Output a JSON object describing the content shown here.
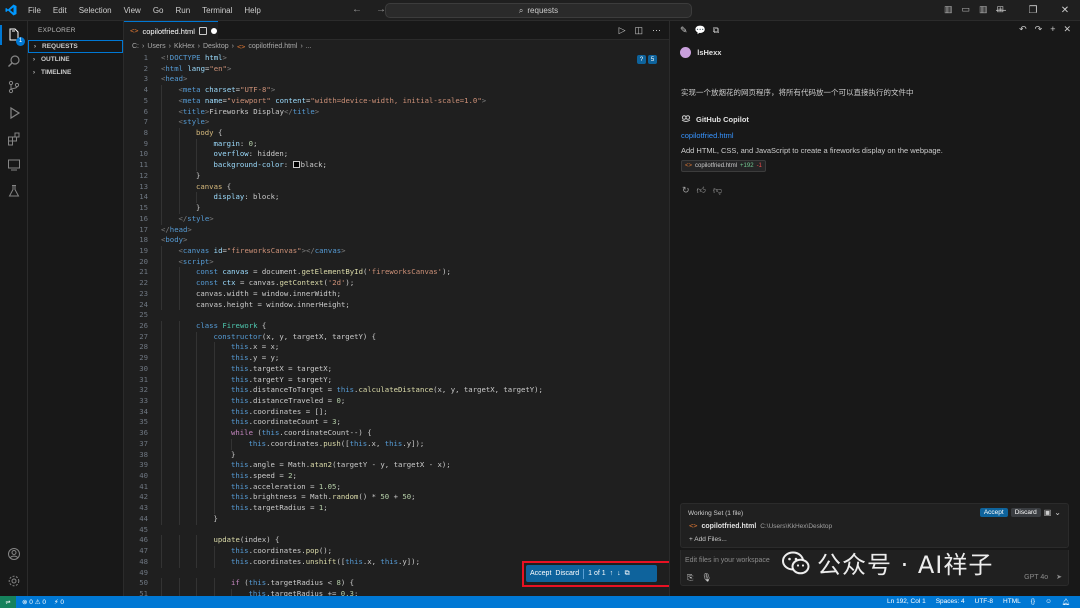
{
  "titlebar": {
    "menu": [
      "File",
      "Edit",
      "Selection",
      "View",
      "Go",
      "Run",
      "Terminal",
      "Help"
    ],
    "search": "requests"
  },
  "activity_bar": {
    "source_control_badge": "1"
  },
  "sidebar": {
    "title": "EXPLORER",
    "sections": [
      "REQUESTS",
      "OUTLINE",
      "TIMELINE"
    ]
  },
  "editor": {
    "tab_label": "copilotfried.html",
    "breadcrumb": [
      "C:",
      "Users",
      "KkHex",
      "Desktop",
      "copilotfried.html",
      "..."
    ],
    "lines": [
      {
        "n": "1",
        "i": 0,
        "h": "<span class='t-br'>&lt;!</span><span class='t-tag'>DOCTYPE</span> <span class='t-attr'>html</span><span class='t-br'>&gt;</span>"
      },
      {
        "n": "2",
        "i": 0,
        "h": "<span class='t-br'>&lt;</span><span class='t-tag'>html</span> <span class='t-attr'>lang</span>=<span class='t-str'>\"en\"</span><span class='t-br'>&gt;</span>"
      },
      {
        "n": "3",
        "i": 0,
        "h": "<span class='t-br'>&lt;</span><span class='t-tag'>head</span><span class='t-br'>&gt;</span>"
      },
      {
        "n": "4",
        "i": 1,
        "h": "<span class='t-br'>&lt;</span><span class='t-tag'>meta</span> <span class='t-attr'>charset</span>=<span class='t-str'>\"UTF-8\"</span><span class='t-br'>&gt;</span>"
      },
      {
        "n": "5",
        "i": 1,
        "h": "<span class='t-br'>&lt;</span><span class='t-tag'>meta</span> <span class='t-attr'>name</span>=<span class='t-str'>\"viewport\"</span> <span class='t-attr'>content</span>=<span class='t-str'>\"width=device-width, initial-scale=1.0\"</span><span class='t-br'>&gt;</span>"
      },
      {
        "n": "6",
        "i": 1,
        "h": "<span class='t-br'>&lt;</span><span class='t-tag'>title</span><span class='t-br'>&gt;</span>Fireworks Display<span class='t-br'>&lt;/</span><span class='t-tag'>title</span><span class='t-br'>&gt;</span>"
      },
      {
        "n": "7",
        "i": 1,
        "h": "<span class='t-br'>&lt;</span><span class='t-tag'>style</span><span class='t-br'>&gt;</span>"
      },
      {
        "n": "8",
        "i": 2,
        "h": "<span class='t-sel'>body</span> {"
      },
      {
        "n": "9",
        "i": 3,
        "h": "<span class='t-attr'>margin</span>: <span class='t-num'>0</span>;"
      },
      {
        "n": "10",
        "i": 3,
        "h": "<span class='t-attr'>overflow</span>: hidden;"
      },
      {
        "n": "11",
        "i": 3,
        "h": "<span class='t-attr'>background-color</span>: <span class='sw'></span>black;"
      },
      {
        "n": "12",
        "i": 2,
        "h": "}"
      },
      {
        "n": "13",
        "i": 2,
        "h": "<span class='t-sel'>canvas</span> {"
      },
      {
        "n": "14",
        "i": 3,
        "h": "<span class='t-attr'>display</span>: block;"
      },
      {
        "n": "15",
        "i": 2,
        "h": "}"
      },
      {
        "n": "16",
        "i": 1,
        "h": "<span class='t-br'>&lt;/</span><span class='t-tag'>style</span><span class='t-br'>&gt;</span>"
      },
      {
        "n": "17",
        "i": 0,
        "h": "<span class='t-br'>&lt;/</span><span class='t-tag'>head</span><span class='t-br'>&gt;</span>"
      },
      {
        "n": "18",
        "i": 0,
        "h": "<span class='t-br'>&lt;</span><span class='t-tag'>body</span><span class='t-br'>&gt;</span>"
      },
      {
        "n": "19",
        "i": 1,
        "h": "<span class='t-br'>&lt;</span><span class='t-tag'>canvas</span> <span class='t-attr'>id</span>=<span class='t-str'>\"fireworksCanvas\"</span><span class='t-br'>&gt;&lt;/</span><span class='t-tag'>canvas</span><span class='t-br'>&gt;</span>"
      },
      {
        "n": "20",
        "i": 1,
        "h": "<span class='t-br'>&lt;</span><span class='t-tag'>script</span><span class='t-br'>&gt;</span>"
      },
      {
        "n": "21",
        "i": 2,
        "h": "<span class='t-kw'>const</span> <span class='t-attr'>canvas</span> = document.<span class='t-fn'>getElementById</span>(<span class='t-str'>'fireworksCanvas'</span>);"
      },
      {
        "n": "22",
        "i": 2,
        "h": "<span class='t-kw'>const</span> <span class='t-attr'>ctx</span> = canvas.<span class='t-fn'>getContext</span>(<span class='t-str'>'2d'</span>);"
      },
      {
        "n": "23",
        "i": 2,
        "h": "canvas.width = window.innerWidth;"
      },
      {
        "n": "24",
        "i": 2,
        "h": "canvas.height = window.innerHeight;"
      },
      {
        "n": "25",
        "i": 0,
        "h": ""
      },
      {
        "n": "26",
        "i": 2,
        "h": "<span class='t-kw'>class</span> <span class='t-cls'>Firework</span> {"
      },
      {
        "n": "27",
        "i": 3,
        "h": "<span class='t-kw'>constructor</span>(x, y, targetX, targetY) {"
      },
      {
        "n": "28",
        "i": 4,
        "h": "<span class='t-kw'>this</span>.x = x;"
      },
      {
        "n": "29",
        "i": 4,
        "h": "<span class='t-kw'>this</span>.y = y;"
      },
      {
        "n": "30",
        "i": 4,
        "h": "<span class='t-kw'>this</span>.targetX = targetX;"
      },
      {
        "n": "31",
        "i": 4,
        "h": "<span class='t-kw'>this</span>.targetY = targetY;"
      },
      {
        "n": "32",
        "i": 4,
        "h": "<span class='t-kw'>this</span>.distanceToTarget = <span class='t-kw'>this</span>.<span class='t-fn'>calculateDistance</span>(x, y, targetX, targetY);"
      },
      {
        "n": "33",
        "i": 4,
        "h": "<span class='t-kw'>this</span>.distanceTraveled = <span class='t-num'>0</span>;"
      },
      {
        "n": "34",
        "i": 4,
        "h": "<span class='t-kw'>this</span>.coordinates = [];"
      },
      {
        "n": "35",
        "i": 4,
        "h": "<span class='t-kw'>this</span>.coordinateCount = <span class='t-num'>3</span>;"
      },
      {
        "n": "36",
        "i": 4,
        "h": "<span class='t-ctl'>while</span> (<span class='t-kw'>this</span>.coordinateCount--) {"
      },
      {
        "n": "37",
        "i": 5,
        "h": "<span class='t-kw'>this</span>.coordinates.<span class='t-fn'>push</span>([<span class='t-kw'>this</span>.x, <span class='t-kw'>this</span>.y]);"
      },
      {
        "n": "38",
        "i": 4,
        "h": "}"
      },
      {
        "n": "39",
        "i": 4,
        "h": "<span class='t-kw'>this</span>.angle = Math.<span class='t-fn'>atan2</span>(targetY - y, targetX - x);"
      },
      {
        "n": "40",
        "i": 4,
        "h": "<span class='t-kw'>this</span>.speed = <span class='t-num'>2</span>;"
      },
      {
        "n": "41",
        "i": 4,
        "h": "<span class='t-kw'>this</span>.acceleration = <span class='t-num'>1.05</span>;"
      },
      {
        "n": "42",
        "i": 4,
        "h": "<span class='t-kw'>this</span>.brightness = Math.<span class='t-fn'>random</span>() * <span class='t-num'>50</span> + <span class='t-num'>50</span>;"
      },
      {
        "n": "43",
        "i": 4,
        "h": "<span class='t-kw'>this</span>.targetRadius = <span class='t-num'>1</span>;"
      },
      {
        "n": "44",
        "i": 3,
        "h": "}"
      },
      {
        "n": "45",
        "i": 0,
        "h": ""
      },
      {
        "n": "46",
        "i": 3,
        "h": "<span class='t-fn'>update</span>(index) {"
      },
      {
        "n": "47",
        "i": 4,
        "h": "<span class='t-kw'>this</span>.coordinates.<span class='t-fn'>pop</span>();"
      },
      {
        "n": "48",
        "i": 4,
        "h": "<span class='t-kw'>this</span>.coordinates.<span class='t-fn'>unshift</span>([<span class='t-kw'>this</span>.x, <span class='t-kw'>this</span>.y]);"
      },
      {
        "n": "49",
        "i": 0,
        "h": ""
      },
      {
        "n": "50",
        "i": 4,
        "h": "<span class='t-ctl'>if</span> (<span class='t-kw'>this</span>.targetRadius &lt; <span class='t-num'>8</span>) {"
      },
      {
        "n": "51",
        "i": 5,
        "h": "<span class='t-kw'>this</span>.targetRadius += <span class='t-num'>0.3</span>;"
      }
    ],
    "accept_bar": {
      "accept": "Accept",
      "discard": "Discard",
      "count": "1 of 1"
    }
  },
  "chat": {
    "user_name": "lsHexx",
    "user_message": "实现一个放烟花的网页程序，将所有代码放一个可以直接执行的文件中",
    "assistant_name": "GitHub Copilot",
    "file_link": "copilotfried.html",
    "description": "Add HTML, CSS, and JavaScript to create a fireworks display on the webpage.",
    "chip": {
      "file": "copilotfried.html",
      "added": "+192",
      "removed": "-1"
    },
    "working_set": {
      "title": "Working Set (1 file)",
      "accept": "Accept",
      "discard": "Discard",
      "file_name": "copilotfried.html",
      "file_path": "C:\\Users\\KkHex\\Desktop",
      "add_files": "+ Add Files..."
    },
    "input_placeholder": "Edit files in your workspace",
    "model": "GPT 4o"
  },
  "watermark": {
    "text": "公众号 · AI祥子"
  },
  "statusbar": {
    "errors": "0",
    "warnings": "0",
    "ports": "0",
    "position": "Ln 192, Col 1",
    "spaces": "Spaces: 4",
    "encoding": "UTF-8",
    "language": "HTML"
  }
}
